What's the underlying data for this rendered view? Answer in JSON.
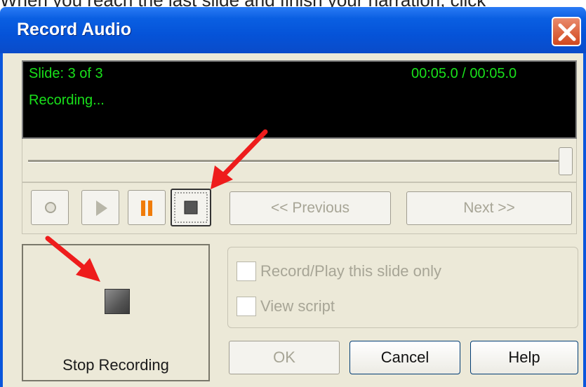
{
  "page": {
    "caption": "When you reach the last slide and finish your narration, click"
  },
  "dialog": {
    "title": "Record Audio",
    "display": {
      "slide_label": "Slide: 3 of 3",
      "status": "Recording...",
      "time": "00:05.0 / 00:05.0"
    },
    "progress": {
      "value_percent": 100
    },
    "controls": {
      "record": {
        "icon": "record-icon"
      },
      "play": {
        "icon": "play-icon"
      },
      "pause": {
        "icon": "pause-icon"
      },
      "stop": {
        "icon": "stop-icon"
      },
      "previous_label": "<< Previous",
      "next_label": "Next >>"
    },
    "big_button": {
      "label": "Stop Recording",
      "icon": "stop-icon"
    },
    "options": {
      "record_slide_only_label": "Record/Play this slide only",
      "view_script_label": "View script"
    },
    "buttons": {
      "ok_label": "OK",
      "cancel_label": "Cancel",
      "help_label": "Help"
    },
    "colors": {
      "titlebar": "#0553d8",
      "display_bg": "#000000",
      "display_text": "#19e11b",
      "pause_orange": "#f07c0a",
      "annotation_arrow": "#ee1c1c",
      "close_button": "#d2481e"
    }
  }
}
